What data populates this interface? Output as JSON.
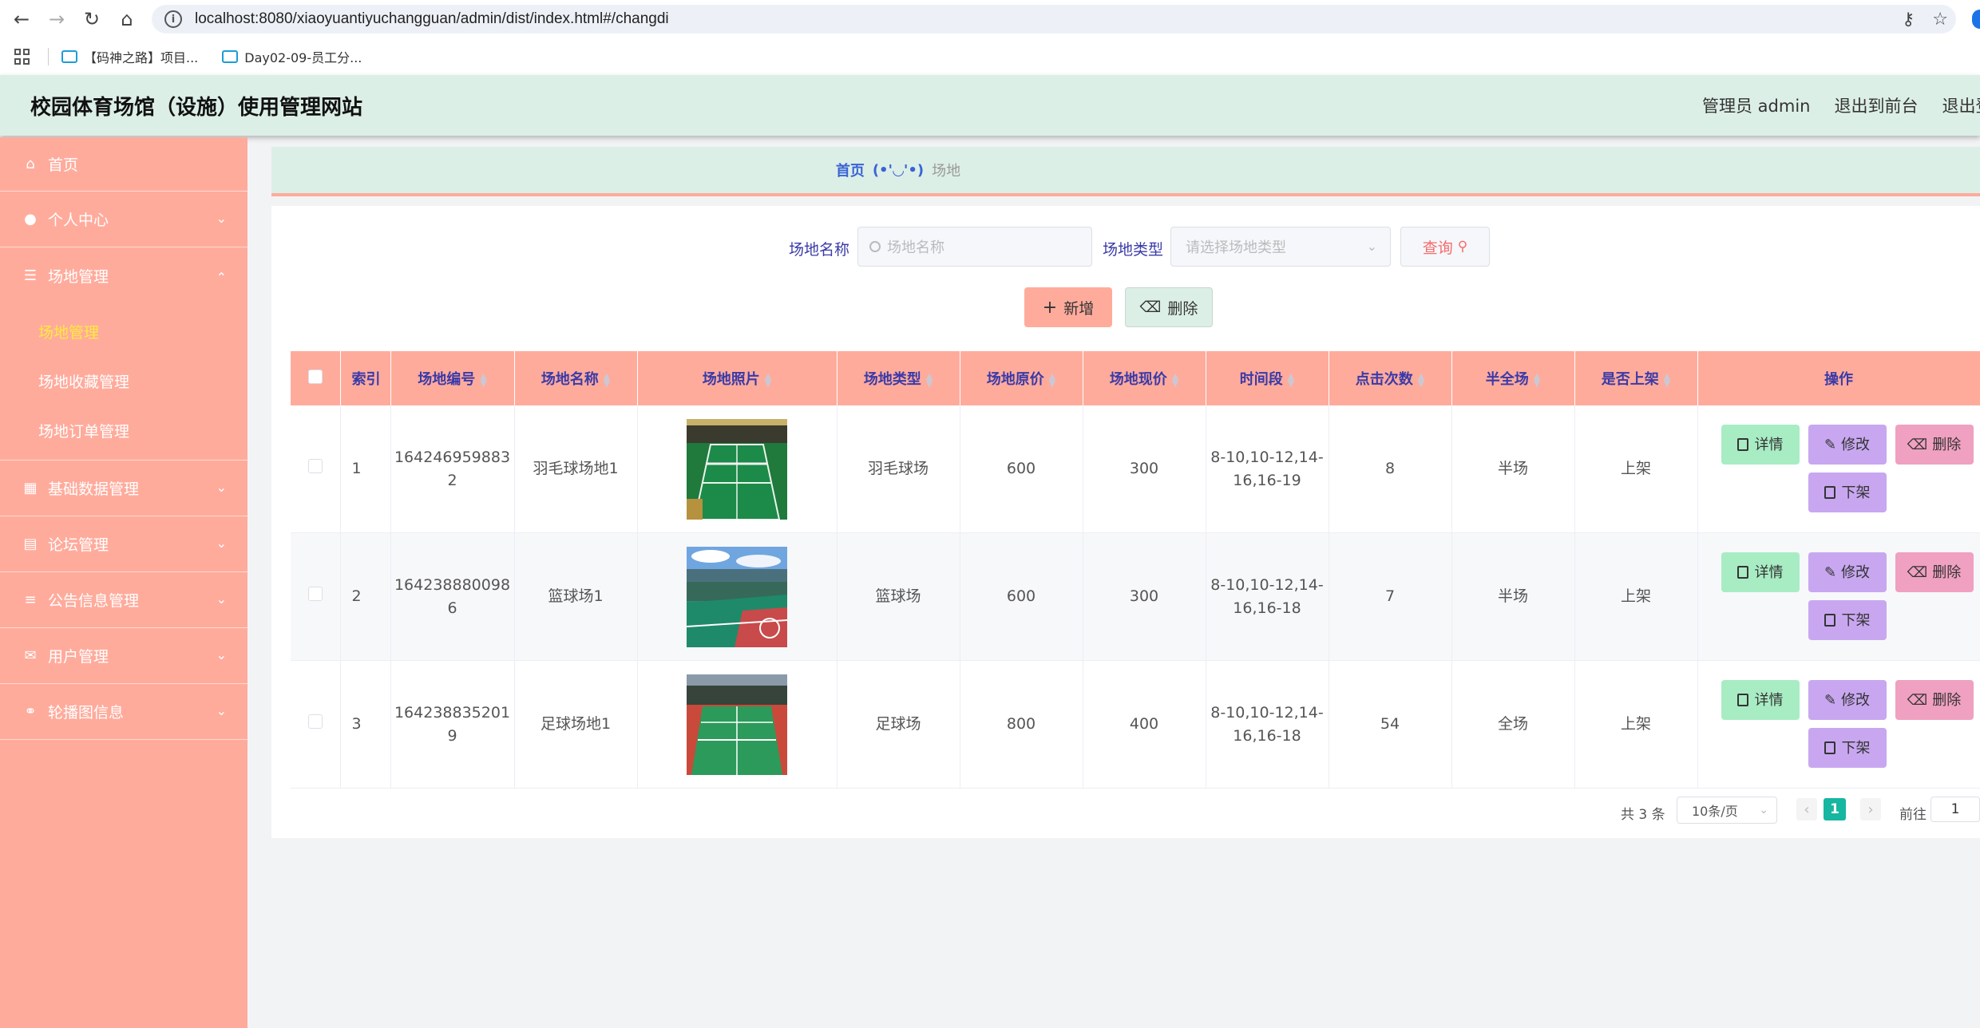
{
  "browser": {
    "url": "localhost:8080/xiaoyuantiyuchangguan/admin/dist/index.html#/changdi",
    "bookmarks": [
      "【码神之路】项目...",
      "Day02-09-员工分..."
    ]
  },
  "header": {
    "title": "校园体育场馆（设施）使用管理网站",
    "user": "管理员 admin",
    "front": "退出到前台",
    "logout": "退出登"
  },
  "sidebar": {
    "home": "首页",
    "personal": "个人中心",
    "venue_mgmt": "场地管理",
    "sub_items": [
      "场地管理",
      "场地收藏管理",
      "场地订单管理"
    ],
    "basic": "基础数据管理",
    "forum": "论坛管理",
    "notice": "公告信息管理",
    "users": "用户管理",
    "carousel": "轮播图信息"
  },
  "breadcrumb": {
    "home": "首页",
    "sep": "(•'◡'•)",
    "current": "场地"
  },
  "search": {
    "name_label": "场地名称",
    "name_placeholder": "场地名称",
    "type_label": "场地类型",
    "type_placeholder": "请选择场地类型",
    "query": "查询"
  },
  "actions": {
    "add": "新增",
    "delete": "删除"
  },
  "table": {
    "headers": [
      "索引",
      "场地编号",
      "场地名称",
      "场地照片",
      "场地类型",
      "场地原价",
      "场地现价",
      "时间段",
      "点击次数",
      "半全场",
      "是否上架",
      "操作"
    ],
    "rows": [
      {
        "index": "1",
        "code": "164246959883\n2",
        "name": "羽毛球场地1",
        "type": "羽毛球场",
        "orig": "600",
        "now": "300",
        "time": "8-10,10-12,14-\n16,16-19",
        "clicks": "8",
        "court": "半场",
        "status": "上架"
      },
      {
        "index": "2",
        "code": "164238880098\n6",
        "name": "篮球场1",
        "type": "篮球场",
        "orig": "600",
        "now": "300",
        "time": "8-10,10-12,14-\n16,16-18",
        "clicks": "7",
        "court": "半场",
        "status": "上架"
      },
      {
        "index": "3",
        "code": "164238835201\n9",
        "name": "足球场地1",
        "type": "足球场",
        "orig": "800",
        "now": "400",
        "time": "8-10,10-12,14-\n16,16-18",
        "clicks": "54",
        "court": "全场",
        "status": "上架"
      }
    ],
    "ops": {
      "detail": "详情",
      "edit": "修改",
      "remove": "删除",
      "down": "下架"
    }
  },
  "pager": {
    "total": "共 3 条",
    "size": "10条/页",
    "current": "1",
    "goto": "前往",
    "goto_value": "1"
  },
  "colors": {
    "sidebar": "#ffab9c",
    "header": "#dcefe6",
    "accent_blue": "#3a3aa8",
    "pager_active": "#16b6a0"
  }
}
